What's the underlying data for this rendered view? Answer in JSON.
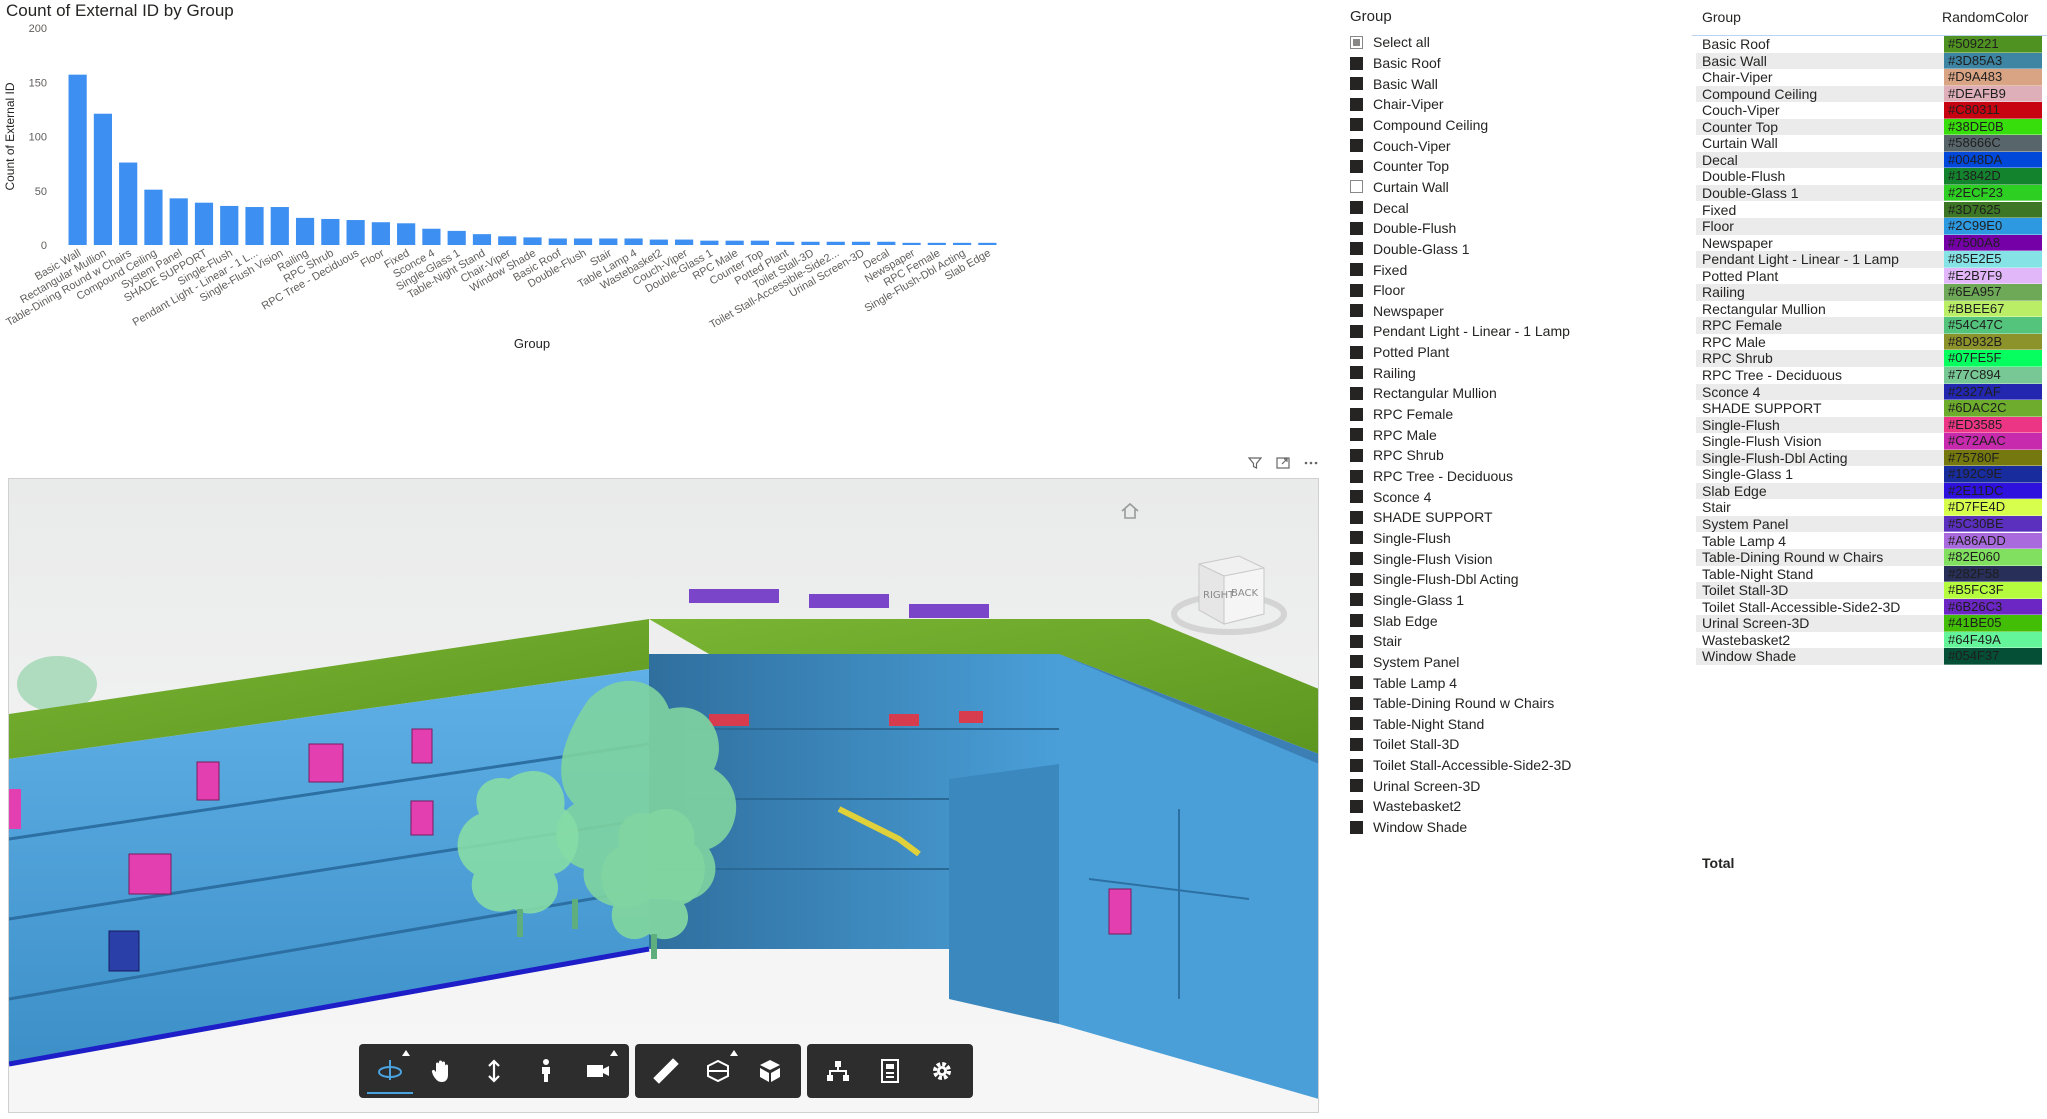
{
  "chart_data": {
    "type": "bar",
    "title": "Count of External ID by Group",
    "xlabel": "Group",
    "ylabel": "Count of External ID",
    "ylim": [
      0,
      200
    ],
    "yticks": [
      0,
      50,
      100,
      150,
      200
    ],
    "bar_color": "#3e8ff2",
    "grid": false,
    "categories": [
      "Basic Wall",
      "Rectangular Mullion",
      "Table-Dining Round w Chairs",
      "Compound Ceiling",
      "System Panel",
      "SHADE SUPPORT",
      "Single-Flush",
      "Pendant Light - Linear - 1 L...",
      "Single-Flush Vision",
      "Railing",
      "RPC Shrub",
      "RPC Tree - Deciduous",
      "Floor",
      "Fixed",
      "Sconce 4",
      "Single-Glass 1",
      "Table-Night Stand",
      "Chair-Viper",
      "Window Shade",
      "Basic Roof",
      "Double-Flush",
      "Stair",
      "Table Lamp 4",
      "Wastebasket2",
      "Couch-Viper",
      "Double-Glass 1",
      "RPC Male",
      "Counter Top",
      "Potted Plant",
      "Toilet Stall-3D",
      "Toilet Stall-Accessible-Side2...",
      "Urinal Screen-3D",
      "Decal",
      "Newspaper",
      "RPC Female",
      "Single-Flush-Dbl Acting",
      "Slab Edge"
    ],
    "values": [
      157,
      121,
      76,
      51,
      43,
      39,
      36,
      35,
      35,
      25,
      24,
      23,
      21,
      20,
      15,
      13,
      10,
      8,
      7,
      6,
      6,
      6,
      6,
      5,
      5,
      4,
      4,
      4,
      3,
      3,
      3,
      3,
      3,
      2,
      2,
      2,
      2
    ]
  },
  "visual_header": {
    "icons": [
      "filter-icon",
      "focus-mode-icon",
      "more-options-icon"
    ]
  },
  "viewer": {
    "view_cube": {
      "faces": [
        "RIGHT",
        "BACK"
      ]
    },
    "toolbar_groups": [
      [
        "orbit-icon",
        "pan-icon",
        "zoom-icon",
        "first-person-icon",
        "camera-icon"
      ],
      [
        "measure-icon",
        "section-icon",
        "explode-icon"
      ],
      [
        "model-browser-icon",
        "properties-icon",
        "settings-icon"
      ]
    ],
    "colors": {
      "glass": "#4a9fd8",
      "roof": "#6aa52a",
      "trees": "#7fd4a0",
      "doors": "#e33fb0",
      "ground": "#f2f2f2"
    }
  },
  "slicer": {
    "title": "Group",
    "select_all": "Select all",
    "items": [
      {
        "label": "Basic Roof",
        "checked": true
      },
      {
        "label": "Basic Wall",
        "checked": true
      },
      {
        "label": "Chair-Viper",
        "checked": true
      },
      {
        "label": "Compound Ceiling",
        "checked": true
      },
      {
        "label": "Couch-Viper",
        "checked": true
      },
      {
        "label": "Counter Top",
        "checked": true
      },
      {
        "label": "Curtain Wall",
        "checked": false
      },
      {
        "label": "Decal",
        "checked": true
      },
      {
        "label": "Double-Flush",
        "checked": true
      },
      {
        "label": "Double-Glass 1",
        "checked": true
      },
      {
        "label": "Fixed",
        "checked": true
      },
      {
        "label": "Floor",
        "checked": true
      },
      {
        "label": "Newspaper",
        "checked": true
      },
      {
        "label": "Pendant Light - Linear - 1 Lamp",
        "checked": true
      },
      {
        "label": "Potted Plant",
        "checked": true
      },
      {
        "label": "Railing",
        "checked": true
      },
      {
        "label": "Rectangular Mullion",
        "checked": true
      },
      {
        "label": "RPC Female",
        "checked": true
      },
      {
        "label": "RPC Male",
        "checked": true
      },
      {
        "label": "RPC Shrub",
        "checked": true
      },
      {
        "label": "RPC Tree - Deciduous",
        "checked": true
      },
      {
        "label": "Sconce 4",
        "checked": true
      },
      {
        "label": "SHADE SUPPORT",
        "checked": true
      },
      {
        "label": "Single-Flush",
        "checked": true
      },
      {
        "label": "Single-Flush Vision",
        "checked": true
      },
      {
        "label": "Single-Flush-Dbl Acting",
        "checked": true
      },
      {
        "label": "Single-Glass 1",
        "checked": true
      },
      {
        "label": "Slab Edge",
        "checked": true
      },
      {
        "label": "Stair",
        "checked": true
      },
      {
        "label": "System Panel",
        "checked": true
      },
      {
        "label": "Table Lamp 4",
        "checked": true
      },
      {
        "label": "Table-Dining Round w Chairs",
        "checked": true
      },
      {
        "label": "Table-Night Stand",
        "checked": true
      },
      {
        "label": "Toilet Stall-3D",
        "checked": true
      },
      {
        "label": "Toilet Stall-Accessible-Side2-3D",
        "checked": true
      },
      {
        "label": "Urinal Screen-3D",
        "checked": true
      },
      {
        "label": "Wastebasket2",
        "checked": true
      },
      {
        "label": "Window Shade",
        "checked": true
      }
    ]
  },
  "table": {
    "headers": [
      "Group",
      "RandomColor"
    ],
    "rows": [
      [
        "Basic Roof",
        "#509221"
      ],
      [
        "Basic Wall",
        "#3D85A3"
      ],
      [
        "Chair-Viper",
        "#D9A483"
      ],
      [
        "Compound Ceiling",
        "#DEAFB9"
      ],
      [
        "Couch-Viper",
        "#C80311"
      ],
      [
        "Counter Top",
        "#38DE0B"
      ],
      [
        "Curtain Wall",
        "#58666C"
      ],
      [
        "Decal",
        "#0048DA"
      ],
      [
        "Double-Flush",
        "#13842D"
      ],
      [
        "Double-Glass 1",
        "#2ECF23"
      ],
      [
        "Fixed",
        "#3D7625"
      ],
      [
        "Floor",
        "#2C99E0"
      ],
      [
        "Newspaper",
        "#7500A8"
      ],
      [
        "Pendant Light - Linear - 1 Lamp",
        "#85E2E5"
      ],
      [
        "Potted Plant",
        "#E2B7F9"
      ],
      [
        "Railing",
        "#6EA957"
      ],
      [
        "Rectangular Mullion",
        "#BBEE67"
      ],
      [
        "RPC Female",
        "#54C47C"
      ],
      [
        "RPC Male",
        "#8D932B"
      ],
      [
        "RPC Shrub",
        "#07FE5F"
      ],
      [
        "RPC Tree - Deciduous",
        "#77C894"
      ],
      [
        "Sconce 4",
        "#2327AF"
      ],
      [
        "SHADE SUPPORT",
        "#6DAC2C"
      ],
      [
        "Single-Flush",
        "#ED3585"
      ],
      [
        "Single-Flush Vision",
        "#C72AAC"
      ],
      [
        "Single-Flush-Dbl Acting",
        "#75780F"
      ],
      [
        "Single-Glass 1",
        "#192C9E"
      ],
      [
        "Slab Edge",
        "#2E11DC"
      ],
      [
        "Stair",
        "#D7FE4D"
      ],
      [
        "System Panel",
        "#5C30BE"
      ],
      [
        "Table Lamp 4",
        "#A86ADD"
      ],
      [
        "Table-Dining Round w Chairs",
        "#82E060"
      ],
      [
        "Table-Night Stand",
        "#282F58"
      ],
      [
        "Toilet Stall-3D",
        "#B5FC3F"
      ],
      [
        "Toilet Stall-Accessible-Side2-3D",
        "#6B26C3"
      ],
      [
        "Urinal Screen-3D",
        "#41BE05"
      ],
      [
        "Wastebasket2",
        "#64F49A"
      ],
      [
        "Window Shade",
        "#054F37"
      ]
    ],
    "total_label": "Total"
  }
}
